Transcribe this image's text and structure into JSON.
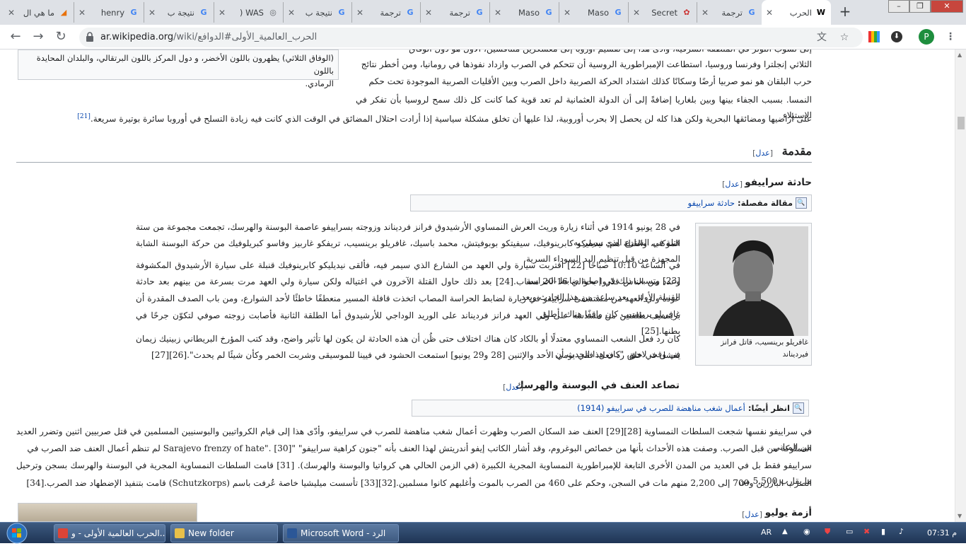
{
  "browser": {
    "tabs": [
      {
        "title": "ما هي ال",
        "color": "#e8710a",
        "glyph": "◢"
      },
      {
        "title": "henry",
        "color": "#4285f4",
        "glyph": "G"
      },
      {
        "title": "نتيجة ب",
        "color": "#4285f4",
        "glyph": "G"
      },
      {
        "title": "WAS (",
        "color": "#5f6368",
        "glyph": "◎"
      },
      {
        "title": "نتيجة ب",
        "color": "#4285f4",
        "glyph": "G"
      },
      {
        "title": "ترجمة",
        "color": "#4285f4",
        "glyph": "G"
      },
      {
        "title": "ترجمة",
        "color": "#4285f4",
        "glyph": "G"
      },
      {
        "title": "Maso",
        "color": "#4285f4",
        "glyph": "G"
      },
      {
        "title": "Maso",
        "color": "#4285f4",
        "glyph": "G"
      },
      {
        "title": "Secret",
        "color": "#c33",
        "glyph": "✿"
      },
      {
        "title": "ترجمة",
        "color": "#4285f4",
        "glyph": "G"
      },
      {
        "title": "الحرب",
        "color": "#000",
        "glyph": "W"
      }
    ],
    "url_domain": "ar.wikipedia.org",
    "url_path": "/wiki/الحرب_العالمية_الأولى#الدوافع",
    "profile_initial": "P"
  },
  "legend": {
    "line1": "(الوفاق الثلاثي) يظهرون باللون الأخضر، و دول المركز باللون البرتقالي، والبلدان المحايدة باللون",
    "line2": "الرمادي."
  },
  "top_paragraph": {
    "l1": "إلى نشوب التوتر في المنطقة الشرقية، وأدى هذا إلى تقسيم أوروبا إلى معسكرين متنافسين، الأول هو دول الوفاق",
    "l2": "الثلاثي إنجلترا وفرنسا وروسيا، استطاعت الإمبراطورية الروسية أن تتحكم في الصرب وازداد نفوذها في رومانيا، ومن أخطر نتائج",
    "l3": "حرب البلقان هو نمو صربيا أرضًا وسكانًا كذلك اشتداد الحركة الصربية داخل الصرب وبين الأقليات الصربية الموجودة تحت حكم",
    "l4": "النمسا. بسبب الجفاء بينها وبين بلغاريا إضافةً إلى أن الدولة العثمانية لم تعد قوية كما كانت كل ذلك سمح لروسيا بأن تفكر في الاستيلاء",
    "l5": "على أراضيها ومضائقها البحرية ولكن هذا كله لن يحصل إلا بحرب أوروبية، لذا عليها أن تخلق مشكلة سياسية إذا أرادت احتلال المضائق في الوقت الذي كانت فيه زيادة التسلح في أوروبا سائرة بوتيرة سريعة.",
    "ref": "[21]"
  },
  "edit_label": "عدل",
  "sections": {
    "intro": "مقدمة",
    "sarajevo": "حادثة سراييفو",
    "violence": "تصاعد العنف في البوسنة والهرسك",
    "july": "أزمة يوليو"
  },
  "hatnote1": {
    "label": "مقالة مفصلة:",
    "link": "حادثة سراييفو"
  },
  "hatnote2": {
    "label": "انظر أيضًا:",
    "link": "أعمال شغب مناهضة للصرب في سراييفو (1914)"
  },
  "thumb_caption": {
    "l1": "غافريلو برينسيب، قاتل فرانز",
    "l2": "فيرديناند"
  },
  "sarajevo_p1": {
    "l1": "في 28 يونيو 1914 في أثناء زيارة وريث العرش النمساوي الأرشيدوق فرانز فرديناند وزوجته بسراييفو عاصمة البوسنة والهرسك، تجمعت مجموعة من ستة قتلة في الشارع الذي سيمر به",
    "l2": "الموكب، والقتلة هم: نيديليكو كابرينوفيك، سيفيتكو بوبوفيتش، محمد باسيك، غافريلو برينسيب، تريفكو غاربيز وفاسو كبريلوفيك من حركة البوسنة الشابة المجهزة من قبل تنظيم اليد السوداء السرية."
  },
  "sarajevo_p2": {
    "l1": "في الساعة 10:10 صباحًا [22] اقتربت سيارة ولي العهد من الشارع الذي سيمر فيه، فألقى نيديليكو كابرينوفيك قنبلة على سيارة الأرشيدوق المكشوفة [23] وتسبب ذلك في إصابة ضابط الحراسة",
    "l2": "وعدد من الناس قدّروا بحوالي 16-20 مصاب.[24] بعد ذلك حاول القتلة الآخرون في اغتياله ولكن سيارة ولي العهد مرت بسرعة من بينهم بعد حادثة القنبلة الأولى. بعد ساعة من هذا الحادث وبعد",
    "l3": "عودة ولي العهد من مستشفى سراييفو في زيارة لضابط الحراسة المصاب اتخذت قافلة المسير منعطفًا خاطئًا لأحد الشوارع، ومن باب الصدف المقدرة أن غافريلو برينسيب كان واقفًا هناك. أطلق",
    "l4": "برينسيب طلقتين من مسدسه على ولي العهد فرانز فرديناند على الوريد الوداجي للأرشيدوق أما الطلقة الثانية فأصابت زوجته صوفي لتكوّن جرحًا في بطنها.[25]"
  },
  "sarajevo_p3": {
    "l1": "كان رد فعل الشعب النمساوي معتدلًا أو بالكاد كان هناك اختلاف حتى ظُن أن هذه الحادثة لن يكون لها تأثير واضح، وقد كتب المؤرخ البريطاني زبينيك زيمان في وقت لاحق، \"كان هذا الحدث أن",
    "l2": "يفشل في خلق رد فعل، ففي يومي الأحد والإثنين [28 و29 يونيو] استمعت الحشود في فيينا للموسيقى وشربت الخمر وكأن شيئًا لم يحدث\".[26][27]"
  },
  "violence_p": {
    "l1": "في سراييفو نفسها شجعت السلطات النمساوية [28][29] العنف ضد السكان الصرب وظهرت أعمال شغب مناهضة للصرب في سراييفو، وأدّى هذا إلى قيام الكرواتيين والبوسنيين المسلمين في قتل صربيين اثنين وتضرر العديد من المباني",
    "l2": "المملوكة من قبل الصرب. وصفت هذه الأحداث بأنها من خصائص البوغروم، وقد أشار الكاتب إيفو أندريتش لهذا العنف بأنه \"جنون كراهية سراييفو\" \"Sarajevo frenzy of hate\". [30] لم تنظم أعمال العنف ضد الصرب في",
    "l3": "سراييفو فقط بل في العديد من المدن الأخرى التابعة للإمبراطورية النمساوية المجرية الكبيرة (في الزمن الحالي هي كرواتيا والبوسنة والهرسك). [31] قامت السلطات النمساوية المجرية في البوسنة والهرسك بسجن وترحيل ما يقارب 5,500 من",
    "l4": "الصرب البارزين و700 إلى 2,200 منهم مات في السجن، وحكم على 460 من الصرب بالموت وأغلبهم كانوا مسلمين.[32][33] تأسست ميليشيا خاصة عُرفت باسم (Schutzkorps) قامت بتنفيذ الإضطهاد ضد الصرب.[34]"
  },
  "taskbar": {
    "items": [
      {
        "label": "الحرب العالمية الأولى - و...",
        "color": "#db4437"
      },
      {
        "label": "New folder",
        "color": "#e8c04a"
      },
      {
        "label": "Microsoft Word - الرد",
        "color": "#2b5797"
      }
    ],
    "lang": "AR",
    "clock": "07:31 م"
  }
}
